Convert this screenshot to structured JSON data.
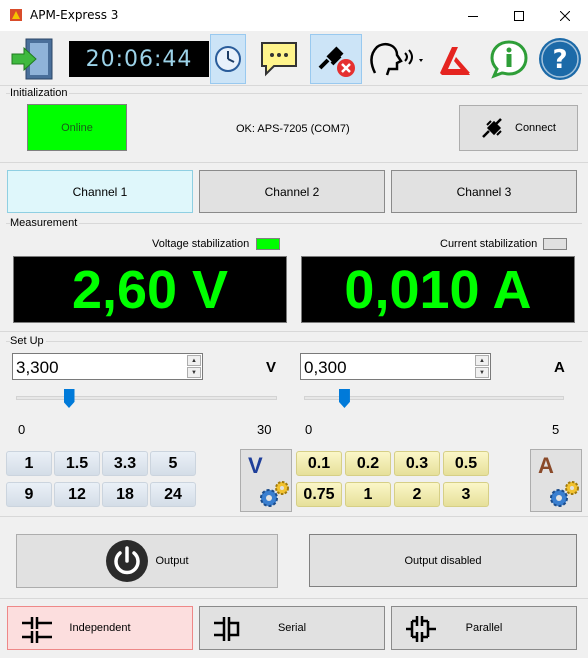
{
  "window": {
    "title": "APM-Express 3"
  },
  "toolbar": {
    "clock": "20:06:44"
  },
  "initialization": {
    "label": "Initialization",
    "online_label": "Online",
    "status": "OK: APS-7205 (COM7)",
    "connect_label": "Connect"
  },
  "channels": [
    "Channel 1",
    "Channel 2",
    "Channel 3"
  ],
  "measurement": {
    "label": "Measurement",
    "voltage_stab_label": "Voltage stabilization",
    "current_stab_label": "Current stabilization",
    "voltage": "2,60 V",
    "current": "0,010 A"
  },
  "setup": {
    "label": "Set Up",
    "voltage_value": "3,300",
    "voltage_unit": "V",
    "current_value": "0,300",
    "current_unit": "A",
    "voltage_min": "0",
    "voltage_max": "30",
    "current_min": "0",
    "current_max": "5",
    "voltage_slider_value": 3.3,
    "voltage_slider_max": 30,
    "current_slider_value": 0.3,
    "current_slider_max": 5
  },
  "voltage_presets": [
    "1",
    "1.5",
    "3.3",
    "5",
    "9",
    "12",
    "18",
    "24"
  ],
  "current_presets": [
    "0.1",
    "0.2",
    "0.3",
    "0.5",
    "0.75",
    "1",
    "2",
    "3"
  ],
  "config": {
    "voltage_letter": "V",
    "current_letter": "A"
  },
  "output": {
    "button_label": "Output",
    "status": "Output disabled"
  },
  "modes": [
    "Independent",
    "Serial",
    "Parallel"
  ],
  "colors": {
    "online": "#00ff00",
    "voltage_stab": "#00ff00",
    "current_stab": "#e0e0e0",
    "display_text": "#00ff00",
    "clock_text": "#9cd2e8",
    "active_channel": "#dff7fb",
    "active_mode": "#fcdede"
  }
}
